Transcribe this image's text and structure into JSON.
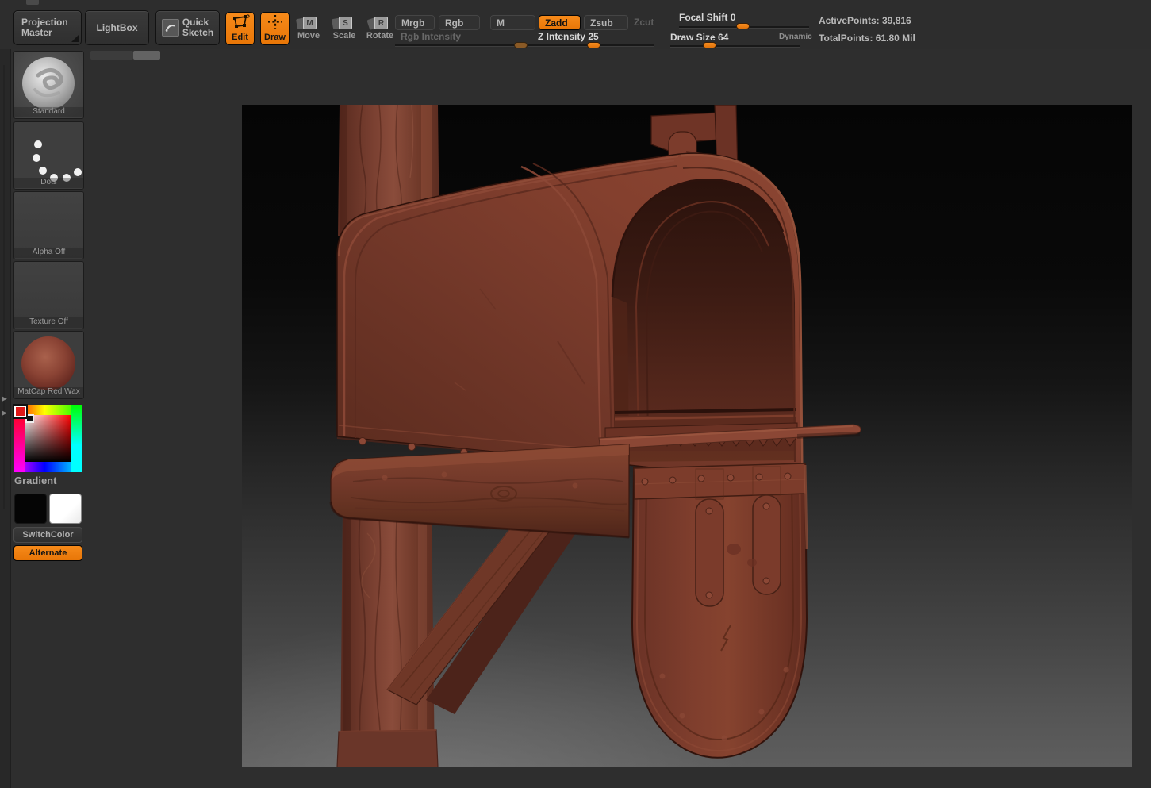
{
  "toolbar": {
    "buttons": {
      "projection_master": {
        "line1": "Projection",
        "line2": "Master"
      },
      "lightbox": "LightBox",
      "quick_sketch": {
        "line1": "Quick",
        "line2": "Sketch"
      },
      "edit": "Edit",
      "draw": "Draw",
      "move": "Move",
      "scale": "Scale",
      "rotate": "Rotate",
      "move_badge": "M",
      "scale_badge": "S",
      "rotate_badge": "R",
      "mrgb": "Mrgb",
      "rgb": "Rgb",
      "m": "M",
      "zadd": "Zadd",
      "zsub": "Zsub",
      "zcut": "Zcut"
    },
    "sliders": {
      "rgb_intensity": {
        "label": "Rgb Intensity",
        "value": ""
      },
      "z_intensity": {
        "label": "Z Intensity",
        "value": "25"
      },
      "focal_shift": {
        "label": "Focal Shift",
        "value": "0"
      },
      "draw_size": {
        "label": "Draw Size",
        "value": "64"
      }
    },
    "dynamic_label": "Dynamic",
    "stats": {
      "active_points_label": "ActivePoints:",
      "active_points_value": "39,816",
      "total_points_label": "TotalPoints:",
      "total_points_value": "61.80  Mil"
    }
  },
  "sidebar": {
    "tiles": [
      {
        "label": "Standard",
        "type": "brush-thumbnail"
      },
      {
        "label": "Dots",
        "type": "stroke-thumbnail"
      },
      {
        "label": "Alpha  Off",
        "type": "alpha-thumbnail"
      },
      {
        "label": "Texture  Off",
        "type": "texture-thumbnail"
      },
      {
        "label": "MatCap  Red  Wax",
        "type": "material-thumbnail"
      }
    ],
    "gradient_label": "Gradient",
    "switch_color_label": "SwitchColor",
    "alternate_label": "Alternate"
  },
  "colors": {
    "accent_orange": "#ee7c12",
    "selected_color": "#e01818",
    "secondary_black": "#000000",
    "secondary_white": "#ffffff",
    "mailbox_red_wax": "#7d3c2d",
    "wood_red": "#7a4134",
    "ui_background": "#2e2e2e",
    "document_top": "#050505",
    "document_bottom": "#5e5e5e"
  },
  "viewport": {
    "scene": "red wax sculpt: rural mailbox with open door on wooden post"
  }
}
